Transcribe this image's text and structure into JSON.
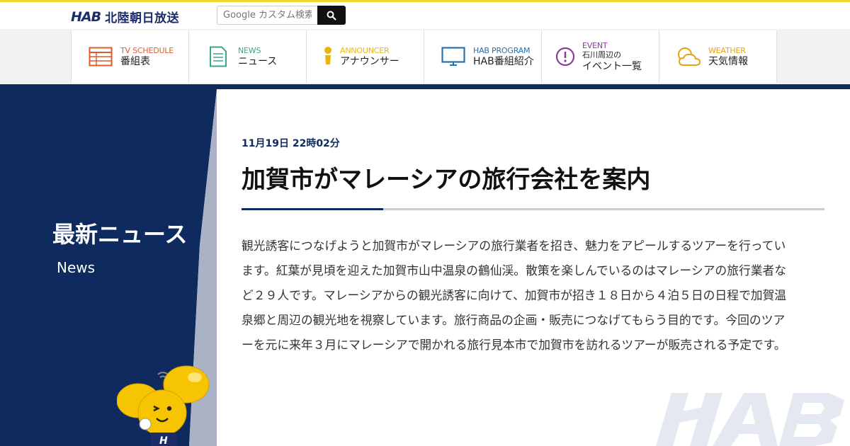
{
  "header": {
    "logo_mark": "HAB",
    "logo_text": "北陸朝日放送",
    "search_placeholder": "Google カスタム検索"
  },
  "nav": [
    {
      "en": "TV SCHEDULE",
      "jp": "番組表",
      "color": "#e05a2b",
      "icon": "tv-schedule-icon"
    },
    {
      "en": "NEWS",
      "jp": "ニュース",
      "color": "#3aa58a",
      "icon": "news-document-icon"
    },
    {
      "en": "ANNOUNCER",
      "jp": "アナウンサー",
      "color": "#e8b60f",
      "icon": "announcer-person-icon"
    },
    {
      "en": "HAB PROGRAM",
      "jp": "HAB番組紹介",
      "color": "#2b6ea8",
      "icon": "monitor-icon"
    },
    {
      "en": "EVENT",
      "jp_line1": "石川周辺の",
      "jp_line2": "イベント一覧",
      "color": "#8a3b9c",
      "icon": "exclamation-circle-icon"
    },
    {
      "en": "WEATHER",
      "jp": "天気情報",
      "color": "#e8a317",
      "icon": "weather-sun-cloud-icon"
    }
  ],
  "sidebar": {
    "title": "最新ニュース",
    "subtitle": "News"
  },
  "article": {
    "date": "11月19日 22時02分",
    "title": "加賀市がマレーシアの旅行会社を案内",
    "body": "観光誘客につなげようと加賀市がマレーシアの旅行業者を招き、魅力をアピールするツアーを行っています。紅葉が見頃を迎えた加賀市山中温泉の鶴仙渓。散策を楽しんでいるのはマレーシアの旅行業者など２９人です。マレーシアからの観光誘客に向けて、加賀市が招き１８日から４泊５日の日程で加賀温泉郷と周辺の観光地を視察しています。旅行商品の企画・販売につなげてもらう目的です。今回のツアーを元に来年３月にマレーシアで開かれる旅行見本市で加賀市を訪れるツアーが販売される予定です。"
  },
  "colors": {
    "brand_navy": "#0f2a5e",
    "accent_yellow": "#f3d62a"
  }
}
